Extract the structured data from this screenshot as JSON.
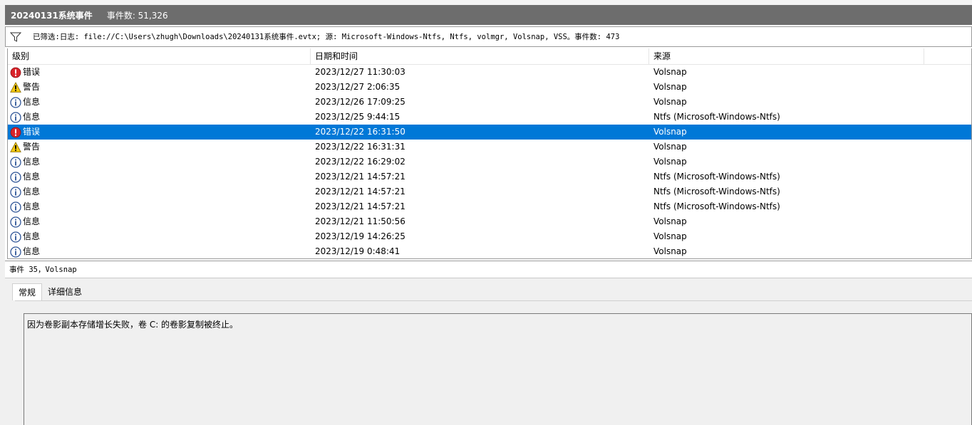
{
  "header": {
    "title": "20240131系统事件",
    "event_count": "事件数: 51,326"
  },
  "filter": {
    "icon": "filter-icon",
    "text": "已筛选:日志: file://C:\\Users\\zhugh\\Downloads\\20240131系统事件.evtx; 源: Microsoft-Windows-Ntfs, Ntfs, volmgr, Volsnap, VSS。事件数: 473"
  },
  "columns": {
    "level": "级别",
    "date": "日期和时间",
    "source": "来源"
  },
  "rows": [
    {
      "level": "错误",
      "icon": "error-icon",
      "date": "2023/12/27 11:30:03",
      "source": "Volsnap",
      "selected": false
    },
    {
      "level": "警告",
      "icon": "warning-icon",
      "date": "2023/12/27 2:06:35",
      "source": "Volsnap",
      "selected": false
    },
    {
      "level": "信息",
      "icon": "info-icon",
      "date": "2023/12/26 17:09:25",
      "source": "Volsnap",
      "selected": false
    },
    {
      "level": "信息",
      "icon": "info-icon",
      "date": "2023/12/25 9:44:15",
      "source": "Ntfs (Microsoft-Windows-Ntfs)",
      "selected": false
    },
    {
      "level": "错误",
      "icon": "error-icon",
      "date": "2023/12/22 16:31:50",
      "source": "Volsnap",
      "selected": true
    },
    {
      "level": "警告",
      "icon": "warning-icon",
      "date": "2023/12/22 16:31:31",
      "source": "Volsnap",
      "selected": false
    },
    {
      "level": "信息",
      "icon": "info-icon",
      "date": "2023/12/22 16:29:02",
      "source": "Volsnap",
      "selected": false
    },
    {
      "level": "信息",
      "icon": "info-icon",
      "date": "2023/12/21 14:57:21",
      "source": "Ntfs (Microsoft-Windows-Ntfs)",
      "selected": false
    },
    {
      "level": "信息",
      "icon": "info-icon",
      "date": "2023/12/21 14:57:21",
      "source": "Ntfs (Microsoft-Windows-Ntfs)",
      "selected": false
    },
    {
      "level": "信息",
      "icon": "info-icon",
      "date": "2023/12/21 14:57:21",
      "source": "Ntfs (Microsoft-Windows-Ntfs)",
      "selected": false
    },
    {
      "level": "信息",
      "icon": "info-icon",
      "date": "2023/12/21 11:50:56",
      "source": "Volsnap",
      "selected": false
    },
    {
      "level": "信息",
      "icon": "info-icon",
      "date": "2023/12/19 14:26:25",
      "source": "Volsnap",
      "selected": false
    },
    {
      "level": "信息",
      "icon": "info-icon",
      "date": "2023/12/19 0:48:41",
      "source": "Volsnap",
      "selected": false
    }
  ],
  "detail": {
    "event_header": "事件 35，Volsnap",
    "tabs": [
      "常规",
      "详细信息"
    ],
    "active_tab": "常规",
    "description": "因为卷影副本存储增长失败，卷 C: 的卷影复制被终止。"
  },
  "colors": {
    "title_bar": "#6d6d6d",
    "selection": "#0078d7",
    "error": "#d9242b",
    "warning": "#f2c811",
    "info": "#2f5597"
  }
}
